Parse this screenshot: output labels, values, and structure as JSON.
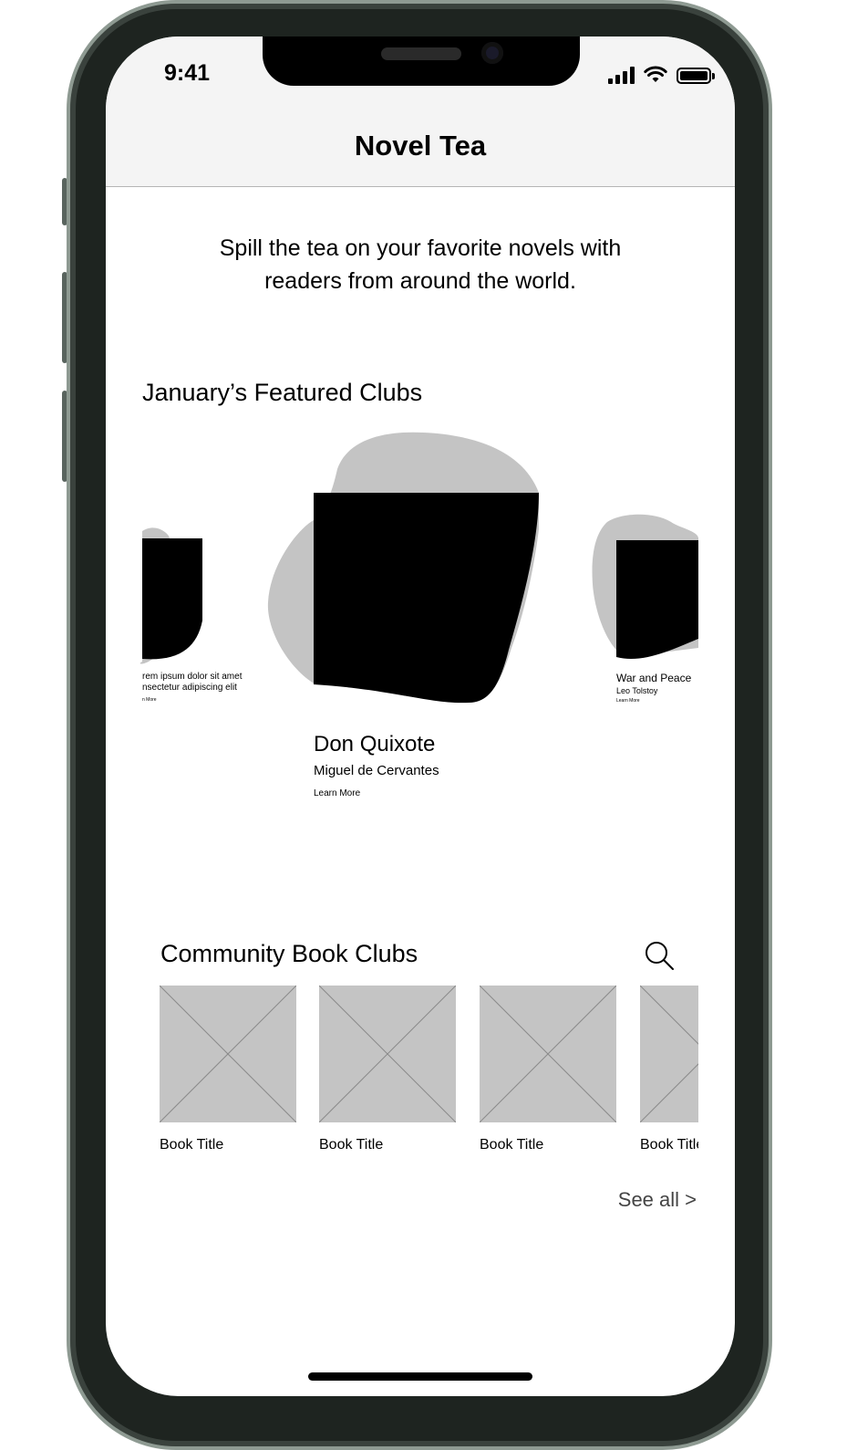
{
  "status_bar": {
    "time": "9:41"
  },
  "nav": {
    "title": "Novel Tea"
  },
  "tagline": "Spill the tea on your favorite novels with readers from around the world.",
  "featured": {
    "heading": "January’s Featured Clubs",
    "clubs": [
      {
        "title": "rem ipsum dolor sit amet, nsectetur adipiscing elit",
        "author": "",
        "link": "n More"
      },
      {
        "title": "Don Quixote",
        "author": "Miguel de Cervantes",
        "link": "Learn More"
      },
      {
        "title": "War and Peace",
        "author": "Leo Tolstoy",
        "link": "Learn More"
      }
    ]
  },
  "community": {
    "heading": "Community Book Clubs",
    "books": [
      {
        "title": "Book Title"
      },
      {
        "title": "Book Title"
      },
      {
        "title": "Book Title"
      },
      {
        "title": "Book Title"
      }
    ],
    "see_all": "See all >"
  },
  "colors": {
    "blob_gray": "#c4c4c4",
    "cover_black": "#000000",
    "nav_bg": "#f4f4f4"
  }
}
